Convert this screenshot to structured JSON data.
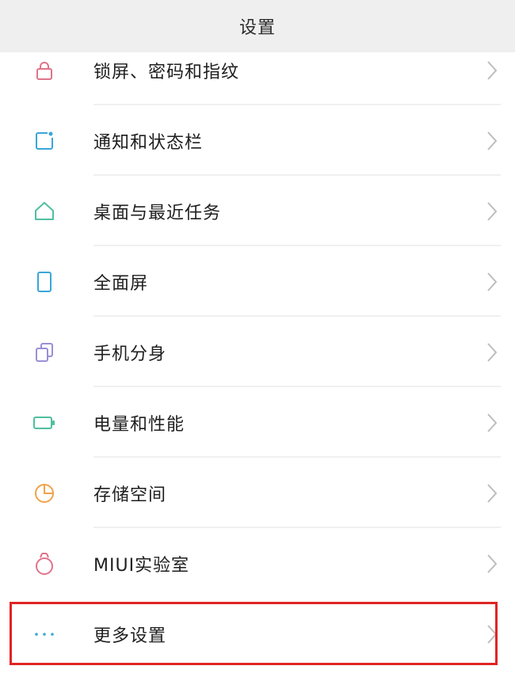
{
  "header": {
    "title": "设置"
  },
  "items": [
    {
      "label": "锁屏、密码和指纹",
      "icon": "lock-icon",
      "color": "#e0738a"
    },
    {
      "label": "通知和状态栏",
      "icon": "notification-icon",
      "color": "#3aa6d8"
    },
    {
      "label": "桌面与最近任务",
      "icon": "home-icon",
      "color": "#4fbf9f"
    },
    {
      "label": "全面屏",
      "icon": "fullscreen-phone-icon",
      "color": "#3aa6d8"
    },
    {
      "label": "手机分身",
      "icon": "dual-space-icon",
      "color": "#9b8fd6"
    },
    {
      "label": "电量和性能",
      "icon": "battery-icon",
      "color": "#4fbf9f"
    },
    {
      "label": "存储空间",
      "icon": "storage-pie-icon",
      "color": "#f0a24a"
    },
    {
      "label": "MIUI实验室",
      "icon": "lab-flask-icon",
      "color": "#e0738a"
    },
    {
      "label": "更多设置",
      "icon": "more-dots-icon",
      "color": "#3aa6d8"
    }
  ],
  "highlight_color": "#e02424"
}
